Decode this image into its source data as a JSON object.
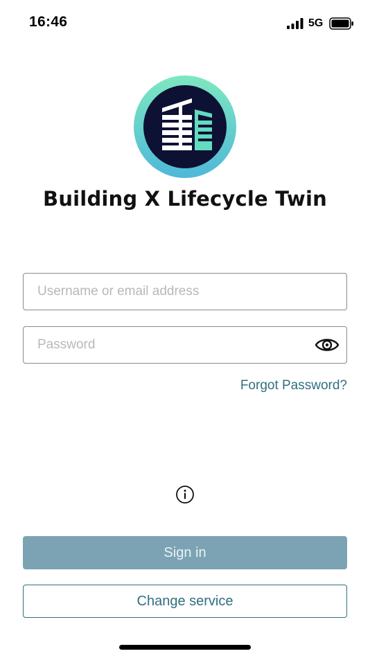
{
  "status_bar": {
    "time": "16:46",
    "network": "5G",
    "signal_icon": "cellular-signal-icon",
    "battery_icon": "battery-full-icon"
  },
  "logo": {
    "icon": "building-logo-icon",
    "colors": {
      "ring_start": "#7ee8c0",
      "ring_end": "#4fb8d8",
      "inner": "#0d1133",
      "building": "#ffffff",
      "accent": "#62dbc0"
    }
  },
  "app_title": "Building X Lifecycle Twin",
  "login_form": {
    "username": {
      "value": "",
      "placeholder": "Username or email address"
    },
    "password": {
      "value": "",
      "placeholder": "Password",
      "toggle_icon": "eye-icon"
    },
    "forgot_password_label": "Forgot Password?"
  },
  "info_icon": "info-icon",
  "buttons": {
    "sign_in_label": "Sign in",
    "change_service_label": "Change service"
  },
  "colors": {
    "accent": "#2f6f80",
    "sign_in_bg": "#7ba3b4"
  }
}
